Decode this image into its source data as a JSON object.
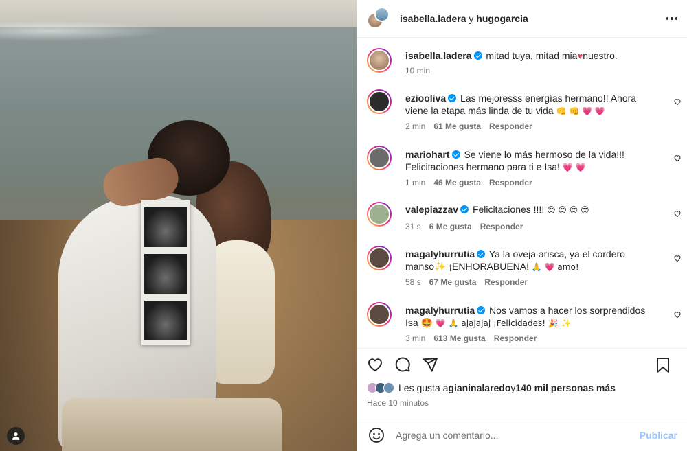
{
  "header": {
    "user1": "isabella.ladera",
    "joiner": " y ",
    "user2": "hugogarcia",
    "more_icon": "more-horizontal-icon"
  },
  "caption": {
    "username": "isabella.ladera",
    "text_pre": "mitad tuya, mitad mia",
    "text_post": "nuestro.",
    "time": "10 min"
  },
  "comments": [
    {
      "username": "eziooliva",
      "text": "Las mejoresss energías hermano!! Ahora viene la etapa más linda de tu vida ",
      "emoji": "👊 👊 💗 💗",
      "time": "2 min",
      "likes": "61 Me gusta",
      "reply": "Responder",
      "avatar_color": "#2b2b2b"
    },
    {
      "username": "mariohart",
      "text": "Se viene lo más hermoso de la vida!!! Felicitaciones hermano para ti e Isa! ",
      "emoji": "💗 💗",
      "time": "1 min",
      "likes": "46 Me gusta",
      "reply": "Responder",
      "avatar_color": "#6b6b6b"
    },
    {
      "username": "valepiazzav",
      "text": "Felicitaciones !!!! ",
      "emoji": "😍 😍 😍 😍",
      "time": "31 s",
      "likes": "6 Me gusta",
      "reply": "Responder",
      "avatar_color": "#9db08f"
    },
    {
      "username": "magalyhurrutia",
      "text": "Ya la oveja arisca, ya el cordero manso✨ ¡ENHORABUENA! ",
      "emoji": "🙏 💗 amo!",
      "time": "58 s",
      "likes": "67 Me gusta",
      "reply": "Responder",
      "avatar_color": "#5a4a3f"
    },
    {
      "username": "magalyhurrutia",
      "text": "Nos vamos a hacer los sorprendidos Isa 🤩 ",
      "emoji": "💗 🙏 ajajajaj ¡Felicidades! 🎉 ✨",
      "time": "3 min",
      "likes": "613 Me gusta",
      "reply": "Responder",
      "avatar_color": "#5a4a3f"
    }
  ],
  "likes": {
    "prefix": "Les gusta a ",
    "user": "gianinalaredo",
    "joiner": " y ",
    "count": "140 mil personas más",
    "ago": "Hace 10 minutos"
  },
  "composer": {
    "placeholder": "Agrega un comentario...",
    "publish": "Publicar"
  },
  "colors": {
    "accent": "#0095f6",
    "publish_disabled": "#9dc5f8",
    "heart": "#e4405f"
  }
}
